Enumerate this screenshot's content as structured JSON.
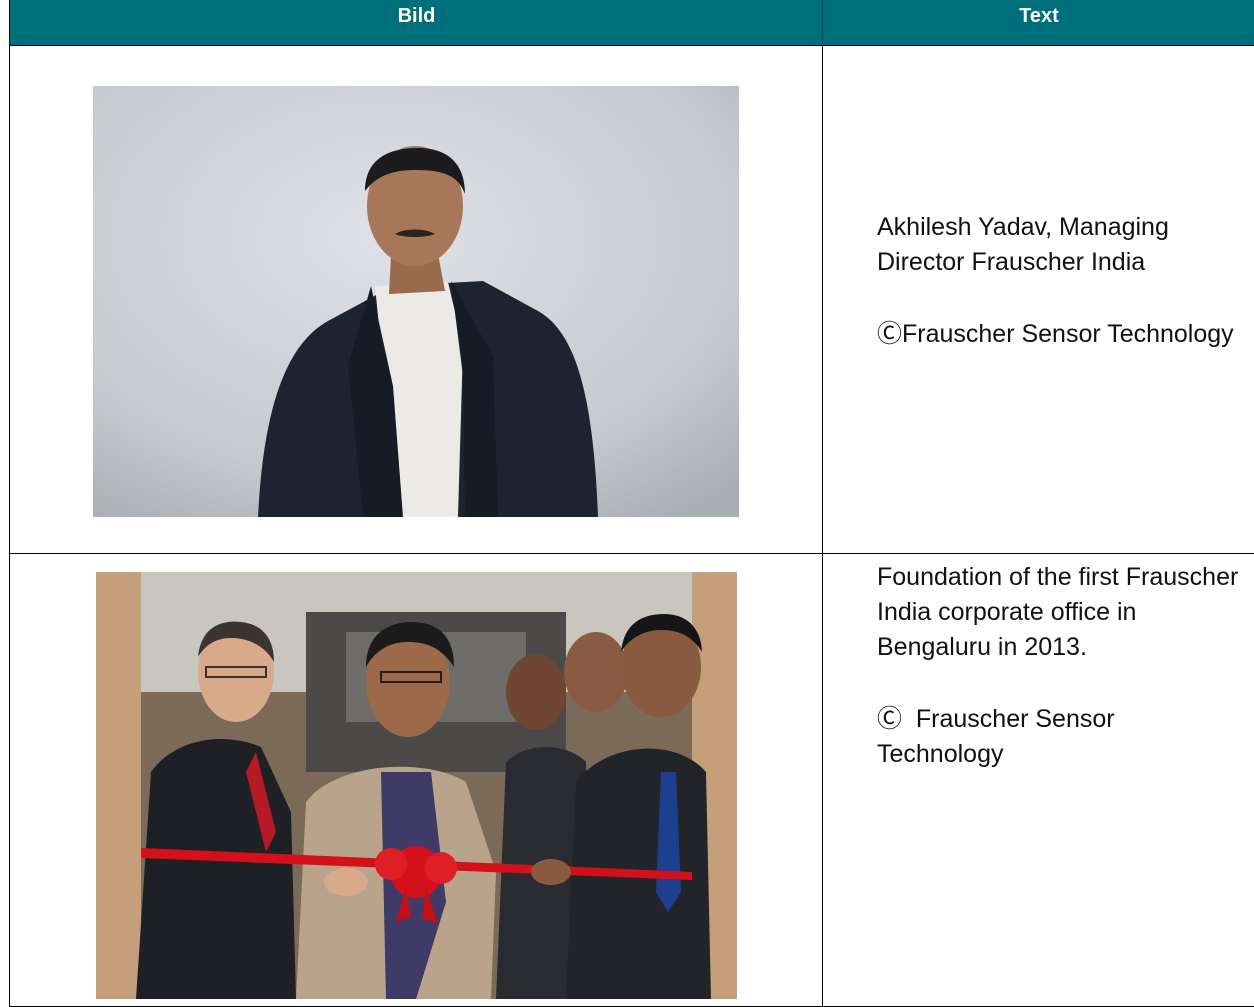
{
  "table": {
    "headers": {
      "image": "Bild",
      "text": "Text"
    },
    "rows": [
      {
        "caption": "Akhilesh Yadav, Managing Director Frauscher India",
        "credit": "ⒸFrauscher Sensor Technology"
      },
      {
        "caption": "Foundation of the first Frauscher India corporate office in Bengaluru in 2013.",
        "credit": "Ⓒ  Frauscher Sensor Technology"
      }
    ]
  },
  "colors": {
    "header_bg": "#006f7c",
    "header_text": "#ffffff",
    "ribbon": "#d4111b"
  }
}
